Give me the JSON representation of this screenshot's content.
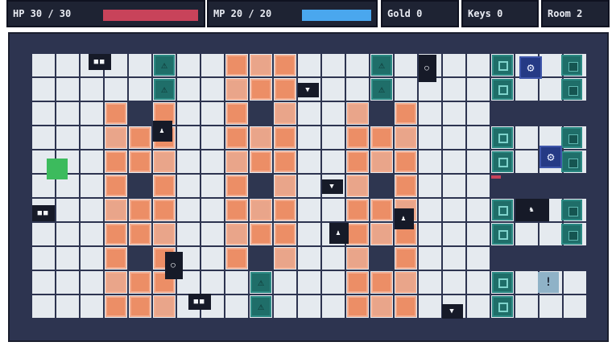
{
  "hud": {
    "hp_label": "HP 30 / 30",
    "hp_fraction": 1.0,
    "hp_color": "#c8435a",
    "mp_label": "MP 20 / 20",
    "mp_fraction": 1.0,
    "mp_color": "#4aa7ee",
    "gold_label": "Gold 0",
    "keys_label": "Keys 0",
    "room_label": "Room 2"
  },
  "colors": {
    "floor": "#e5eaef",
    "lava": "#ec8e66",
    "wall": "#2d3450",
    "trap": "#1f6e69",
    "enemy": "#161a28",
    "player": "#3cbb5d"
  },
  "icons": {
    "trap": "warning-triangle",
    "gear": "gear",
    "knight": "knight",
    "pawn": "pawn",
    "alert": "exclamation"
  }
}
